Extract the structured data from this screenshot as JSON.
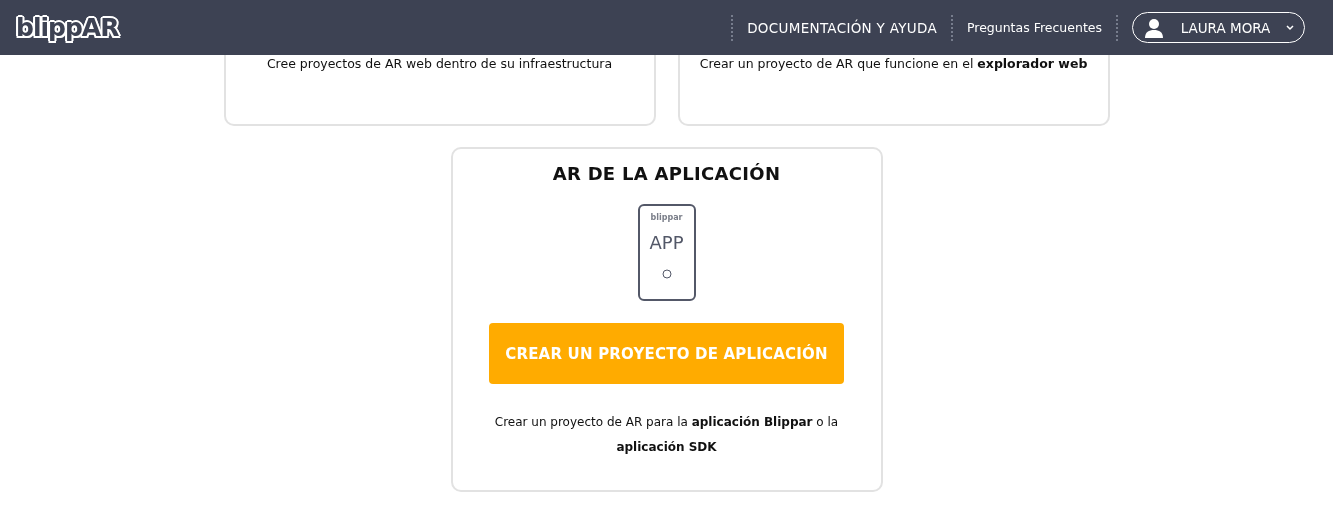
{
  "header": {
    "logo": "blippAR",
    "nav": [
      {
        "label": "DOCUMENTACIÓN Y AYUDA"
      },
      {
        "label": "Preguntas Frecuentes"
      }
    ],
    "user": {
      "name": "LAURA MORA"
    }
  },
  "top_cards": [
    {
      "description": "Cree proyectos de AR web dentro de su infraestructura"
    },
    {
      "description": "Crear un proyecto de AR que funcione en el **explorador web**"
    }
  ],
  "app_card": {
    "title": "AR DE LA APLICACIÓN",
    "phone_logo": "blippar",
    "phone_label": "APP",
    "button": "CREAR UN PROYECTO DE APLICACIÓN",
    "description": "Crear un proyecto de AR para la **aplicación Blippar** o la **aplicación SDK**"
  }
}
